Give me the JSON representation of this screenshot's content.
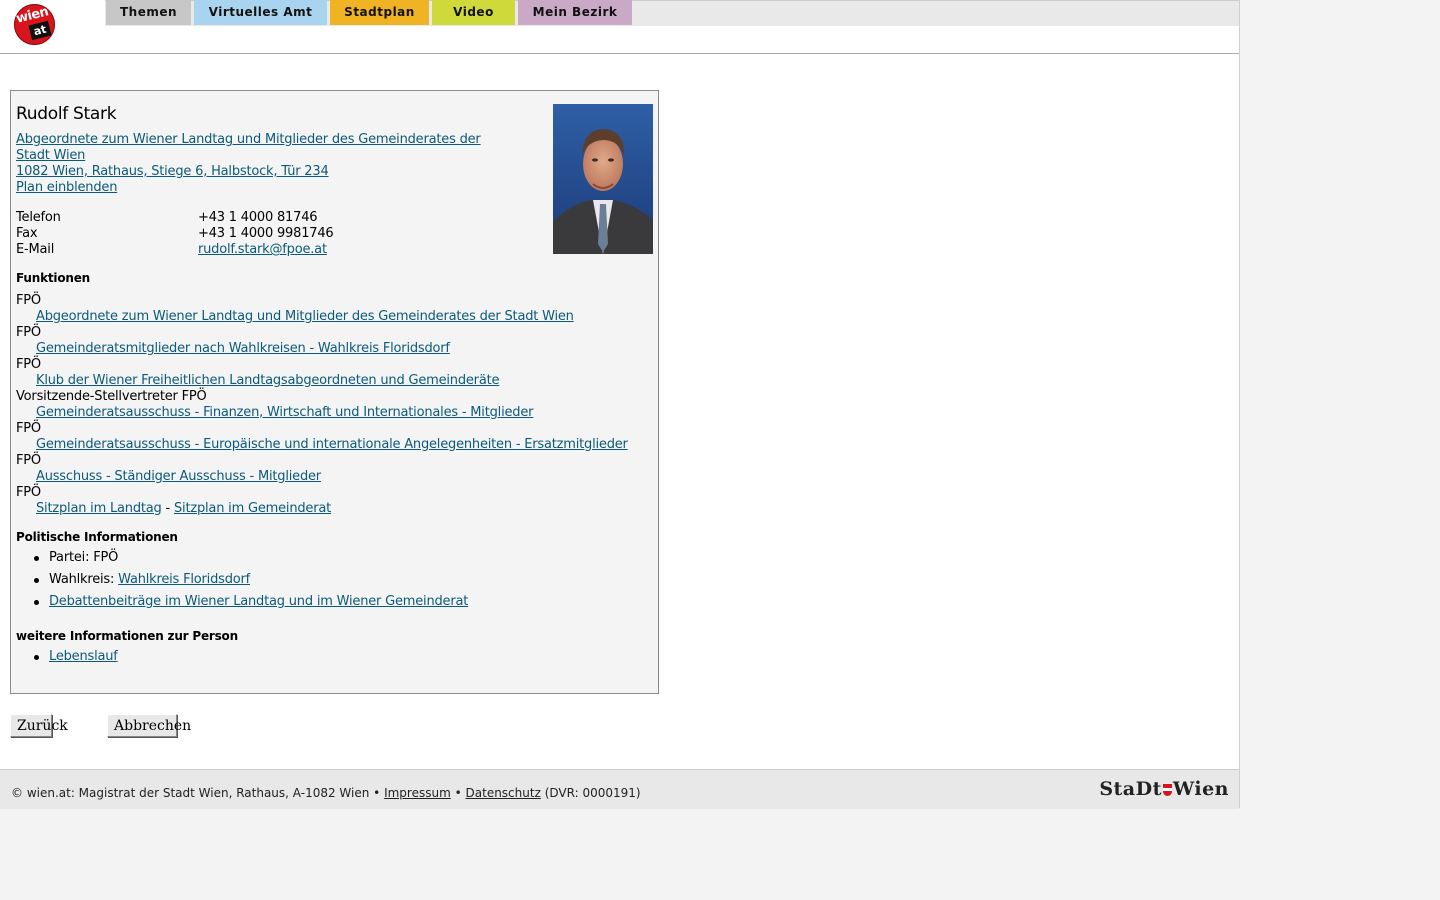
{
  "header": {
    "logo": {
      "word": "wien",
      "suffix": "at"
    },
    "nav": [
      "Themen",
      "Virtuelles Amt",
      "Stadtplan",
      "Video",
      "Mein Bezirk"
    ]
  },
  "person": {
    "name": "Rudolf Stark",
    "affiliation_line1": "Abgeordnete zum Wiener Landtag und Mitglieder des Gemeinderates der",
    "affiliation_line2": "Stadt Wien ",
    "address": "1082 Wien, Rathaus, Stiege 6, Halbstock, Tür 234",
    "map_link": "Plan einblenden",
    "photo_alt": "Portrait Rudolf Stark"
  },
  "contact": {
    "phone_label": "Telefon",
    "phone": "+43 1 4000 81746",
    "fax_label": "Fax",
    "fax": "+43 1 4000 9981746",
    "email_label": "E-Mail",
    "email": "rudolf.stark@fpoe.at"
  },
  "functions": {
    "heading": "Funktionen",
    "items": [
      {
        "role": "FPÖ",
        "link": "Abgeordnete zum Wiener Landtag und Mitglieder des Gemeinderates der Stadt Wien"
      },
      {
        "role": "FPÖ",
        "link": "Gemeinderatsmitglieder nach Wahlkreisen - Wahlkreis Floridsdorf"
      },
      {
        "role": "FPÖ",
        "link": "Klub der Wiener Freiheitlichen Landtagsabgeordneten und Gemeinderäte"
      },
      {
        "role": "Vorsitzende-Stellvertreter FPÖ",
        "link": "Gemeinderatsausschuss - Finanzen, Wirtschaft und Internationales - Mitglieder"
      },
      {
        "role": "FPÖ",
        "link": "Gemeinderatsausschuss - Europäische und internationale Angelegenheiten - Ersatzmitglieder"
      },
      {
        "role": "FPÖ",
        "link": "Ausschuss - Ständiger Ausschuss - Mitglieder"
      },
      {
        "role": "FPÖ",
        "link": ""
      }
    ],
    "seat_landtag": "Sitzplan im Landtag",
    "seat_sep": " - ",
    "seat_gemeinderat": "Sitzplan im Gemeinderat"
  },
  "political": {
    "heading": "Politische Informationen",
    "party_label": "Partei: ",
    "party": "FPÖ",
    "district_label": "Wahlkreis: ",
    "district": "Wahlkreis Floridsdorf",
    "debates": "Debattenbeiträge im Wiener Landtag und im Wiener Gemeinderat"
  },
  "more": {
    "heading": "weitere Informationen zur Person",
    "cv": "Lebenslauf"
  },
  "buttons": {
    "back": "Zurück",
    "cancel": "Abbrechen"
  },
  "footer": {
    "text": "© wien.at: Magistrat der Stadt Wien, Rathaus, A-1082 Wien •",
    "imprint": "Impressum",
    "sep": "•",
    "privacy": "Datenschutz",
    "dvr": "(DVR: 0000191)",
    "brand_left": "StaDt",
    "brand_right": "Wien"
  },
  "colors": {
    "link": "#0b5a7a",
    "tab_themen": "#c7c7c7",
    "tab_virtuelles_amt": "#a8d4ef",
    "tab_stadtplan": "#f0b323",
    "tab_video": "#d0d93a",
    "tab_mein_bezirk": "#c9a9c6",
    "logo_red": "#d8141c"
  }
}
